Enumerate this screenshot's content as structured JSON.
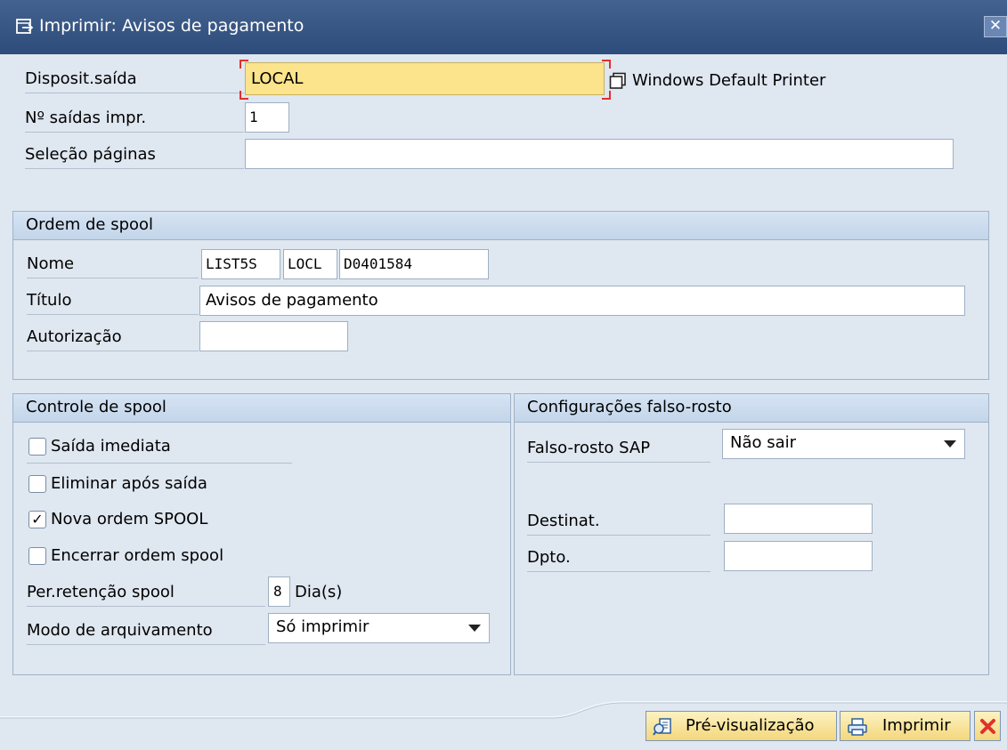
{
  "window": {
    "title": "Imprimir: Avisos de pagamento",
    "icon": "print-dialog-icon",
    "close_icon": "close-icon"
  },
  "output": {
    "device_label": "Disposit.saída",
    "device_value": "LOCAL",
    "device_description": "Windows Default Printer",
    "copies_label": "Nº saídas impr.",
    "copies_value": "1",
    "page_selection_label": "Seleção páginas",
    "page_selection_value": ""
  },
  "spool_request": {
    "heading": "Ordem de spool",
    "name_label": "Nome",
    "name_parts": [
      "LIST5S",
      "LOCL",
      "D0401584"
    ],
    "title_label": "Título",
    "title_value": "Avisos de pagamento",
    "authorization_label": "Autorização",
    "authorization_value": ""
  },
  "spool_control": {
    "heading": "Controle de spool",
    "options": [
      {
        "label": "Saída imediata",
        "checked": false
      },
      {
        "label": "Eliminar após saída",
        "checked": false
      },
      {
        "label": "Nova ordem SPOOL",
        "checked": true
      },
      {
        "label": "Encerrar ordem spool",
        "checked": false
      }
    ],
    "check_glyph": "✓",
    "retention_label": "Per.retenção spool",
    "retention_value": "8",
    "retention_unit": "Dia(s)",
    "archive_label": "Modo de arquivamento",
    "archive_value": "Só imprimir"
  },
  "cover_page": {
    "heading": "Configurações falso-rosto",
    "sap_cover_label": "Falso-rosto SAP",
    "sap_cover_value": "Não sair",
    "recipient_label": "Destinat.",
    "recipient_value": "",
    "department_label": "Dpto.",
    "department_value": ""
  },
  "footer": {
    "preview_label": "Pré-visualização",
    "print_label": "Imprimir",
    "cancel_icon": "cancel-icon"
  },
  "colors": {
    "titlebar": "#2d4c7b",
    "background": "#dfe7f0",
    "focused_field": "#fbe48b",
    "cancel": "#e0312c"
  }
}
